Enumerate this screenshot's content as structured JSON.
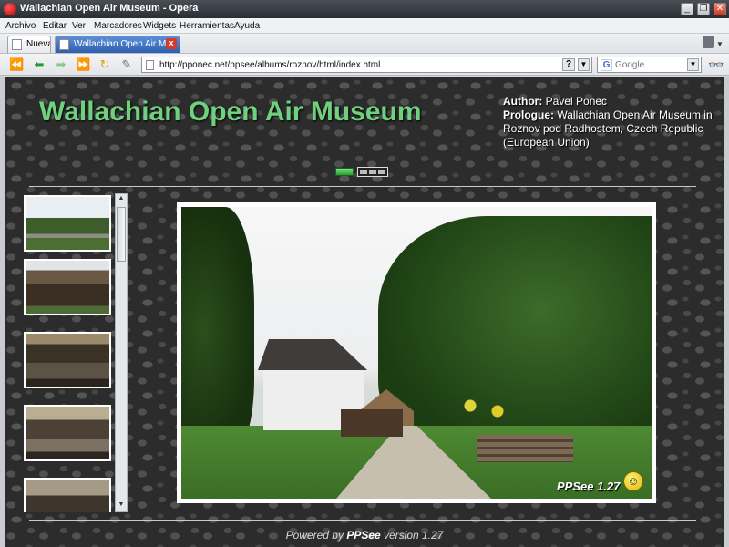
{
  "window": {
    "title": "Wallachian Open Air Museum - Opera"
  },
  "menu": [
    "Archivo",
    "Editar",
    "Ver",
    "Marcadores",
    "Widgets",
    "Herramientas",
    "Ayuda"
  ],
  "tabs": [
    {
      "label": "Nueva"
    },
    {
      "label": "Wallachian Open Air Mus..."
    }
  ],
  "address": {
    "url": "http://pponec.net/ppsee/albums/roznov/html/index.html",
    "help": "?"
  },
  "search": {
    "placeholder": "Google"
  },
  "page": {
    "title": "Wallachian Open Air Museum",
    "author_label": "Author:",
    "author_value": "Pavel Ponec",
    "prologue_label": "Prologue:",
    "prologue_value": "Wallachian Open Air Museum in Roznov pod Radhostem, Czech Republic (European Union)",
    "watermark": "PPSee 1.27",
    "footer_prefix": "Powered by ",
    "footer_brand": "PPSee",
    "footer_suffix": " version 1.27"
  },
  "icons": {
    "nav": [
      "rewind-icon",
      "back-icon",
      "forward-icon",
      "fast-forward-icon",
      "reload-icon",
      "wand-icon"
    ],
    "misc": [
      "trash-icon",
      "glasses-icon",
      "smiley-icon",
      "page-icon"
    ]
  },
  "colors": {
    "title_green": "#6fd07e",
    "tab_active": "#2d5fae"
  }
}
